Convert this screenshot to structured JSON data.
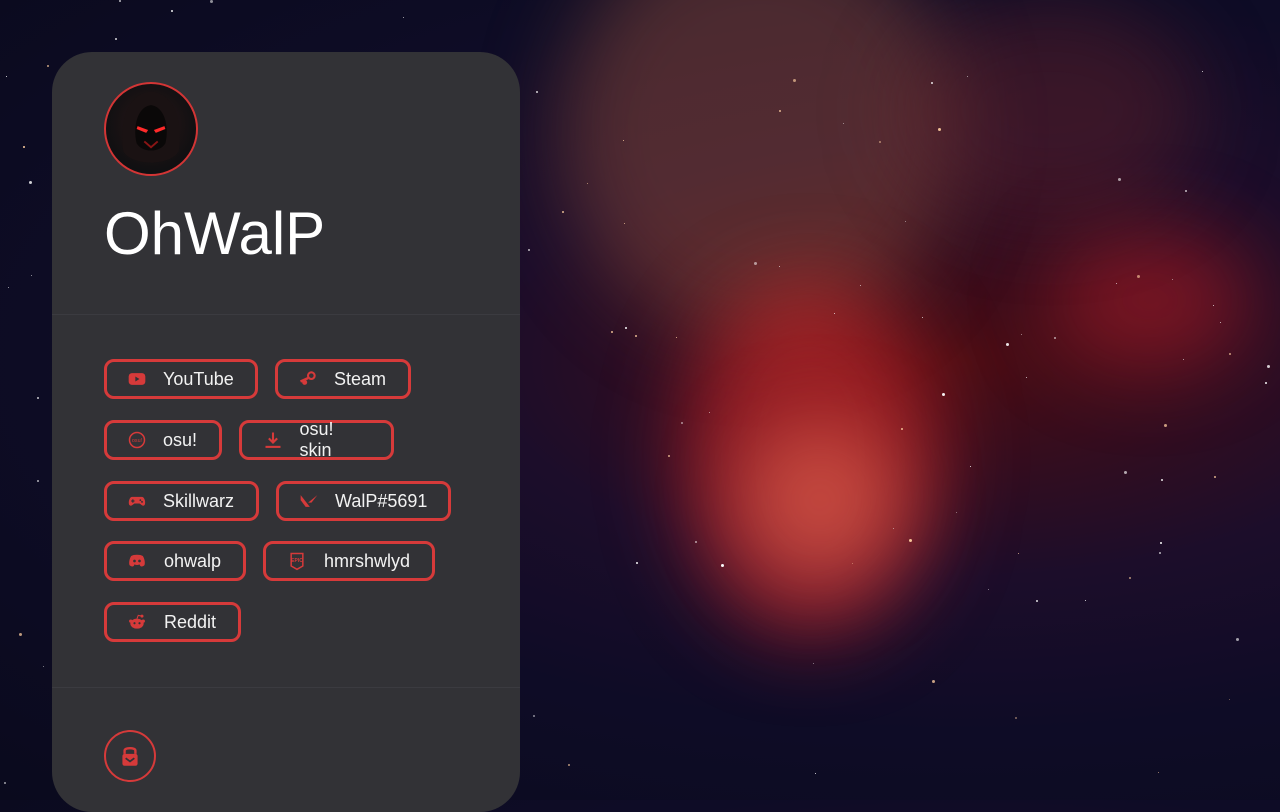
{
  "profile": {
    "name": "OhWalP"
  },
  "links": [
    {
      "label": "YouTube",
      "icon": "youtube-icon"
    },
    {
      "label": "Steam",
      "icon": "steam-icon"
    },
    {
      "label": "osu!",
      "icon": "osu-icon"
    },
    {
      "label": "osu! skin",
      "icon": "download-icon"
    },
    {
      "label": "Skillwarz",
      "icon": "gamepad-icon"
    },
    {
      "label": "WalP#5691",
      "icon": "valorant-icon"
    },
    {
      "label": "ohwalp",
      "icon": "discord-icon"
    },
    {
      "label": "hmrshwlyd",
      "icon": "epic-games-icon"
    },
    {
      "label": "Reddit",
      "icon": "reddit-icon"
    }
  ],
  "footer": {
    "icon": "keybase-icon"
  },
  "colors": {
    "accent": "#d63a3a",
    "card": "#323236",
    "text": "#ffffff"
  }
}
